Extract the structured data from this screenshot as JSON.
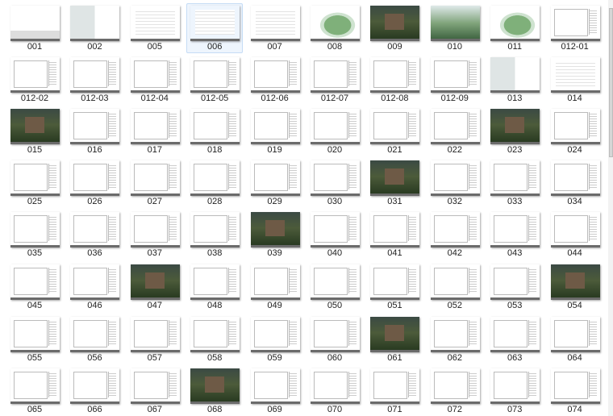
{
  "selected": "006",
  "items": [
    {
      "name": "001",
      "type": "cover"
    },
    {
      "name": "002",
      "type": "split"
    },
    {
      "name": "005",
      "type": "doc"
    },
    {
      "name": "006",
      "type": "doc"
    },
    {
      "name": "007",
      "type": "doc"
    },
    {
      "name": "008",
      "type": "map"
    },
    {
      "name": "009",
      "type": "photo"
    },
    {
      "name": "010",
      "type": "landscape"
    },
    {
      "name": "011",
      "type": "map"
    },
    {
      "name": "012-01",
      "type": "drawing"
    },
    {
      "name": "012-02",
      "type": "drawing"
    },
    {
      "name": "012-03",
      "type": "drawing"
    },
    {
      "name": "012-04",
      "type": "drawing"
    },
    {
      "name": "012-05",
      "type": "drawing"
    },
    {
      "name": "012-06",
      "type": "drawing"
    },
    {
      "name": "012-07",
      "type": "drawing"
    },
    {
      "name": "012-08",
      "type": "drawing"
    },
    {
      "name": "012-09",
      "type": "drawing"
    },
    {
      "name": "013",
      "type": "split"
    },
    {
      "name": "014",
      "type": "doc"
    },
    {
      "name": "015",
      "type": "photo"
    },
    {
      "name": "016",
      "type": "drawing"
    },
    {
      "name": "017",
      "type": "drawing"
    },
    {
      "name": "018",
      "type": "drawing"
    },
    {
      "name": "019",
      "type": "drawing"
    },
    {
      "name": "020",
      "type": "drawing"
    },
    {
      "name": "021",
      "type": "drawing"
    },
    {
      "name": "022",
      "type": "drawing"
    },
    {
      "name": "023",
      "type": "photo"
    },
    {
      "name": "024",
      "type": "drawing"
    },
    {
      "name": "025",
      "type": "drawing"
    },
    {
      "name": "026",
      "type": "drawing"
    },
    {
      "name": "027",
      "type": "drawing"
    },
    {
      "name": "028",
      "type": "drawing"
    },
    {
      "name": "029",
      "type": "drawing"
    },
    {
      "name": "030",
      "type": "drawing"
    },
    {
      "name": "031",
      "type": "photo"
    },
    {
      "name": "032",
      "type": "drawing"
    },
    {
      "name": "033",
      "type": "drawing"
    },
    {
      "name": "034",
      "type": "drawing"
    },
    {
      "name": "035",
      "type": "drawing"
    },
    {
      "name": "036",
      "type": "drawing"
    },
    {
      "name": "037",
      "type": "drawing"
    },
    {
      "name": "038",
      "type": "drawing"
    },
    {
      "name": "039",
      "type": "photo"
    },
    {
      "name": "040",
      "type": "drawing"
    },
    {
      "name": "041",
      "type": "drawing"
    },
    {
      "name": "042",
      "type": "drawing"
    },
    {
      "name": "043",
      "type": "drawing"
    },
    {
      "name": "044",
      "type": "drawing"
    },
    {
      "name": "045",
      "type": "drawing"
    },
    {
      "name": "046",
      "type": "drawing"
    },
    {
      "name": "047",
      "type": "photo"
    },
    {
      "name": "048",
      "type": "drawing"
    },
    {
      "name": "049",
      "type": "drawing"
    },
    {
      "name": "050",
      "type": "drawing"
    },
    {
      "name": "051",
      "type": "drawing"
    },
    {
      "name": "052",
      "type": "drawing"
    },
    {
      "name": "053",
      "type": "drawing"
    },
    {
      "name": "054",
      "type": "photo"
    },
    {
      "name": "055",
      "type": "drawing"
    },
    {
      "name": "056",
      "type": "drawing"
    },
    {
      "name": "057",
      "type": "drawing"
    },
    {
      "name": "058",
      "type": "drawing"
    },
    {
      "name": "059",
      "type": "drawing"
    },
    {
      "name": "060",
      "type": "drawing"
    },
    {
      "name": "061",
      "type": "photo"
    },
    {
      "name": "062",
      "type": "drawing"
    },
    {
      "name": "063",
      "type": "drawing"
    },
    {
      "name": "064",
      "type": "drawing"
    },
    {
      "name": "065",
      "type": "drawing"
    },
    {
      "name": "066",
      "type": "drawing"
    },
    {
      "name": "067",
      "type": "drawing"
    },
    {
      "name": "068",
      "type": "photo"
    },
    {
      "name": "069",
      "type": "drawing"
    },
    {
      "name": "070",
      "type": "drawing"
    },
    {
      "name": "071",
      "type": "drawing"
    },
    {
      "name": "072",
      "type": "drawing"
    },
    {
      "name": "073",
      "type": "drawing"
    },
    {
      "name": "074",
      "type": "drawing"
    }
  ]
}
